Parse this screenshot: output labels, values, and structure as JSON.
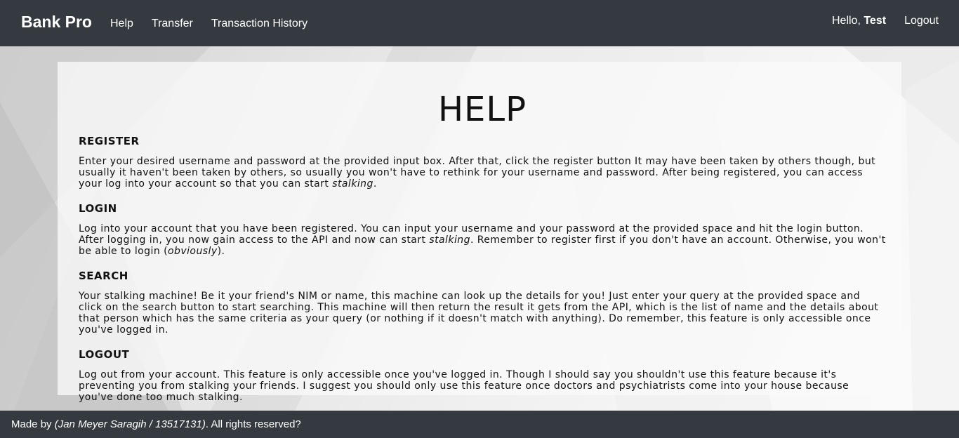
{
  "navbar": {
    "brand": "Bank Pro",
    "links": [
      "Help",
      "Transfer",
      "Transaction History"
    ],
    "greeting_prefix": "Hello,",
    "username": "Test",
    "logout": "Logout"
  },
  "main": {
    "title": "HELP",
    "sections": [
      {
        "heading": "REGISTER",
        "text_a": "Enter your desired username and password at the provided input box. After that, click the register button It may have been taken by others though, but usually it haven't been taken by others, so usually you won't have to rethink for your username and password. After being registered, you can access your log into your account so that you can start ",
        "em_a": "stalking",
        "text_b": "."
      },
      {
        "heading": "LOGIN",
        "text_a": "Log into your account that you have been registered. You can input your username and your password at the provided space and hit the login button. After logging in, you now gain access to the API and now can start ",
        "em_a": "stalking",
        "text_b": ". Remember to register first if you don't have an account. Otherwise, you won't be able to login (",
        "em_b": "obviously",
        "text_c": ")."
      },
      {
        "heading": "SEARCH",
        "text_a": "Your stalking machine! Be it your friend's NIM or name, this machine can look up the details for you! Just enter your query at the provided space and click on the search button to start searching. This machine will then return the result it gets from the API, which is the list of name and the details about that person which has the same criteria as your query (or nothing if it doesn't match with anything). Do remember, this feature is only accessible once you've logged in."
      },
      {
        "heading": "LOGOUT",
        "text_a": "Log out from your account. This feature is only accessible once you've logged in. Though I should say you shouldn't use this feature because it's preventing you from stalking your friends. I suggest you should only use this feature once doctors and psychiatrists come into your house because you've done too much stalking."
      }
    ]
  },
  "footer": {
    "prefix": "Made by ",
    "author": "(Jan Meyer Saragih / 13517131)",
    "suffix": ". All rights reserved?"
  },
  "colors": {
    "navbar_bg": "#343a40",
    "footer_bg": "#343a40",
    "text": "#111111"
  }
}
